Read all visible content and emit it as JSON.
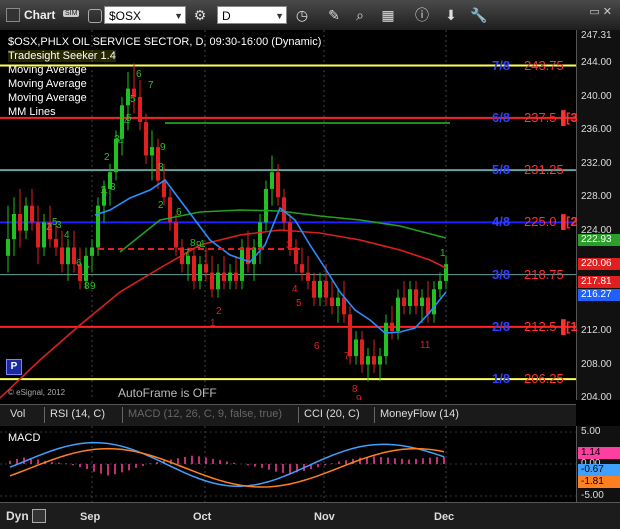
{
  "toolbar": {
    "title": "Chart",
    "sim_badge": "SIM",
    "symbol": "$OSX",
    "interval": "D",
    "icons": [
      "chart-window-icon",
      "link-icon",
      "settings-icon",
      "clock-icon",
      "draw-icon",
      "zoom-icon",
      "grid-icon",
      "info-icon",
      "down-arrow-icon",
      "wrench-icon"
    ]
  },
  "chart": {
    "header": "$OSX,PHLX OIL SERVICE SECTOR, D, 09:30-16:00 (Dynamic)",
    "studies": [
      "Tradesight Seeker 1.4",
      "Moving Average",
      "Moving Average",
      "Moving Average",
      "MM Lines"
    ],
    "copyright": "© eSignal, 2012",
    "autoframe": "AutoFrame is OFF",
    "bottom_marker": "P",
    "mm_lines": [
      {
        "label": "7/8",
        "value": "243.75",
        "color": "#ffff55"
      },
      {
        "label": "6/8",
        "value": "237.5▐",
        "suffix": "3",
        "color": "#ff2222"
      },
      {
        "label": "5/8",
        "value": "231.25",
        "color": "#6aa0a0"
      },
      {
        "label": "4/8",
        "value": "225.0▐",
        "suffix": "2",
        "color": "#2020ff"
      },
      {
        "label": "3/8",
        "value": "218.75",
        "color": "#6aa0a0"
      },
      {
        "label": "2/8",
        "value": "212.5▐",
        "suffix": "1",
        "color": "#ff2222"
      },
      {
        "label": "1/8",
        "value": "206.25",
        "color": "#ffff55"
      }
    ],
    "price_ticks": [
      "247.31",
      "244.00",
      "240.00",
      "236.00",
      "232.00",
      "228.00",
      "224.00",
      "220.00",
      "216.00",
      "212.00",
      "208.00",
      "204.00"
    ],
    "price_badges": [
      {
        "value": "222.93",
        "color": "#2aa02a"
      },
      {
        "value": "220.06",
        "color": "#e02020"
      },
      {
        "value": "217.81",
        "color": "#e02020"
      },
      {
        "value": "216.27",
        "color": "#2060ff"
      }
    ],
    "x_labels": [
      "Sep",
      "Oct",
      "Nov",
      "Dec"
    ],
    "green_counts": [
      "1",
      "2",
      "3",
      "4",
      "5",
      "6",
      "7",
      "8",
      "9",
      "1",
      "2",
      "3",
      "4",
      "5",
      "6",
      "7",
      "8",
      "9",
      "1",
      "2",
      "3",
      "4",
      "5",
      "6",
      "7",
      "8",
      "9",
      "1"
    ],
    "red_counts": [
      "1",
      "2",
      "3",
      "4",
      "5",
      "6",
      "7",
      "8",
      "9",
      "11"
    ]
  },
  "tabs": [
    {
      "label": "Vol"
    },
    {
      "label": "RSI (14, C)"
    },
    {
      "label": "MACD (12, 26, C, 9, false, true)"
    },
    {
      "label": "CCI (20, C)"
    },
    {
      "label": "MoneyFlow (14)"
    }
  ],
  "macd": {
    "label": "MACD",
    "axis_ticks": [
      "5.00",
      "0.00",
      "-5.00"
    ],
    "badges": [
      {
        "value": "1.14",
        "color": "#ff3fa0"
      },
      {
        "value": "-0.67",
        "color": "#40a0ff"
      },
      {
        "value": "-1.81",
        "color": "#ff8020"
      }
    ]
  },
  "bottom": {
    "dyn_label": "Dyn",
    "x_labels": [
      "Sep",
      "Oct",
      "Nov",
      "Dec"
    ]
  }
}
